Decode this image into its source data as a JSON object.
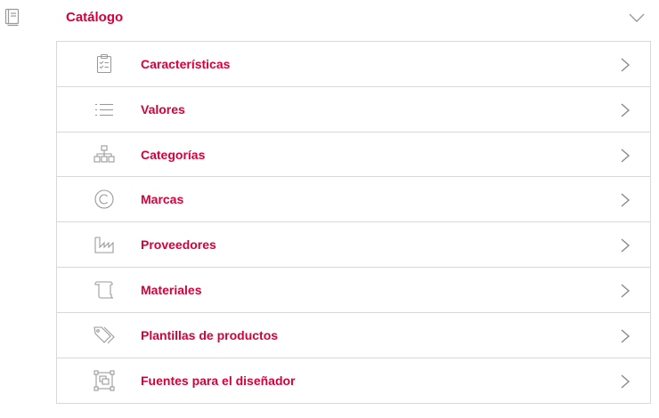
{
  "section": {
    "title": "Catálogo",
    "icon": "book-icon",
    "expanded": true
  },
  "menu": {
    "items": [
      {
        "label": "Características",
        "icon": "clipboard-checklist-icon"
      },
      {
        "label": "Valores",
        "icon": "list-icon"
      },
      {
        "label": "Categorías",
        "icon": "sitemap-icon"
      },
      {
        "label": "Marcas",
        "icon": "copyright-icon"
      },
      {
        "label": "Proveedores",
        "icon": "factory-icon"
      },
      {
        "label": "Materiales",
        "icon": "scroll-icon"
      },
      {
        "label": "Plantillas de productos",
        "icon": "tags-icon"
      },
      {
        "label": "Fuentes para el diseñador",
        "icon": "frame-layers-icon"
      }
    ]
  },
  "colors": {
    "accent": "#d6003b",
    "icon": "#9a9a9a",
    "border": "#d8d8d8"
  }
}
